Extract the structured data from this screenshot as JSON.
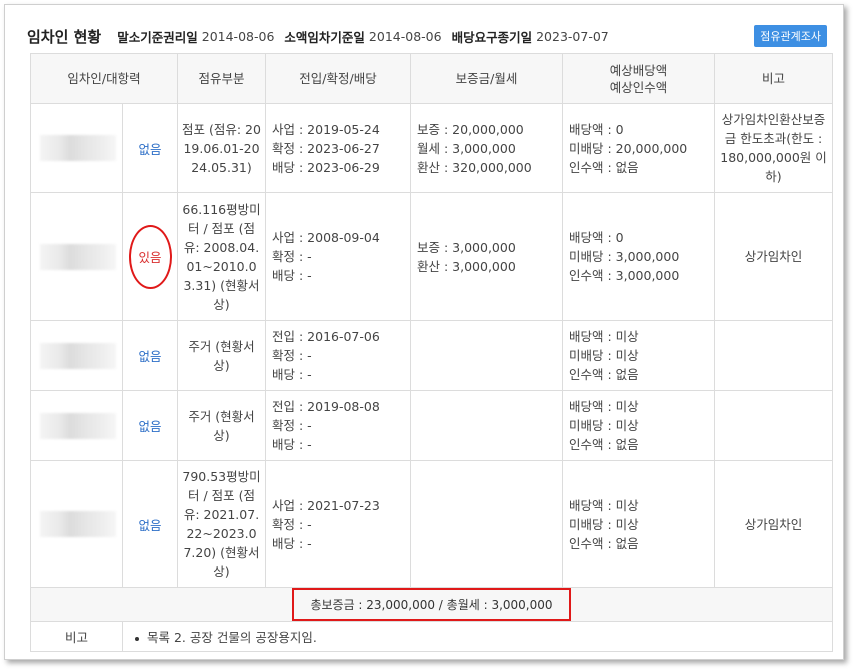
{
  "header": {
    "title": "임차인 현황",
    "items": [
      {
        "label": "말소기준권리일",
        "value": "2014-08-06"
      },
      {
        "label": "소액임차기준일",
        "value": "2014-08-06"
      },
      {
        "label": "배당요구종기일",
        "value": "2023-07-07"
      }
    ],
    "survey_button": "점유관계조사"
  },
  "columns": {
    "tenant": "임차인/대항력",
    "occupancy": "점유부분",
    "dates": "전입/확정/배당",
    "deposit": "보증금/월세",
    "dividend_line1": "예상배당액",
    "dividend_line2": "예상인수액",
    "note": "비고"
  },
  "rows": [
    {
      "opposing_power": "없음",
      "occupancy": "점포 (점유: 2019.06.01-2024.05.31)",
      "dates": [
        "사업 : 2019-05-24",
        "확정 : 2023-06-27",
        "배당 : 2023-06-29"
      ],
      "deposit": [
        "보증 : 20,000,000",
        "월세 : 3,000,000",
        "환산 : 320,000,000"
      ],
      "dividend": [
        "배당액 : 0",
        "미배당 : 20,000,000",
        "인수액 : 없음"
      ],
      "note": "상가임차인환산보증금 한도초과(한도 : 180,000,000원 이하)"
    },
    {
      "opposing_power": "있음",
      "occupancy": "66.116평방미터 / 점포 (점유: 2008.04.01~2010.03.31) (현황서상)",
      "dates": [
        "사업 : 2008-09-04",
        "확정 : -",
        "배당 : -"
      ],
      "deposit": [
        "보증 : 3,000,000",
        "환산 : 3,000,000"
      ],
      "dividend": [
        "배당액 : 0",
        "미배당 : 3,000,000",
        "인수액 : 3,000,000"
      ],
      "note": "상가임차인"
    },
    {
      "opposing_power": "없음",
      "occupancy": "주거 (현황서상)",
      "dates": [
        "전입 : 2016-07-06",
        "확정 : -",
        "배당 : -"
      ],
      "deposit": [],
      "dividend": [
        "배당액 : 미상",
        "미배당 : 미상",
        "인수액 : 없음"
      ],
      "note": ""
    },
    {
      "opposing_power": "없음",
      "occupancy": "주거 (현황서상)",
      "dates": [
        "전입 : 2019-08-08",
        "확정 : -",
        "배당 : -"
      ],
      "deposit": [],
      "dividend": [
        "배당액 : 미상",
        "미배당 : 미상",
        "인수액 : 없음"
      ],
      "note": ""
    },
    {
      "opposing_power": "없음",
      "occupancy": "790.53평방미터 / 점포 (점유: 2021.07.22~2023.07.20) (현황서상)",
      "dates": [
        "사업 : 2021-07-23",
        "확정 : -",
        "배당 : -"
      ],
      "deposit": [],
      "dividend": [
        "배당액 : 미상",
        "미배당 : 미상",
        "인수액 : 없음"
      ],
      "note": "상가임차인"
    }
  ],
  "summary": "총보증금 : 23,000,000  /  총월세 : 3,000,000",
  "remark": {
    "label": "비고",
    "content": "목록 2. 공장 건물의 공장용지임."
  },
  "colors": {
    "link_blue": "#2e6fc7",
    "highlight_red": "#e01919",
    "button_blue": "#3d8fe3"
  }
}
